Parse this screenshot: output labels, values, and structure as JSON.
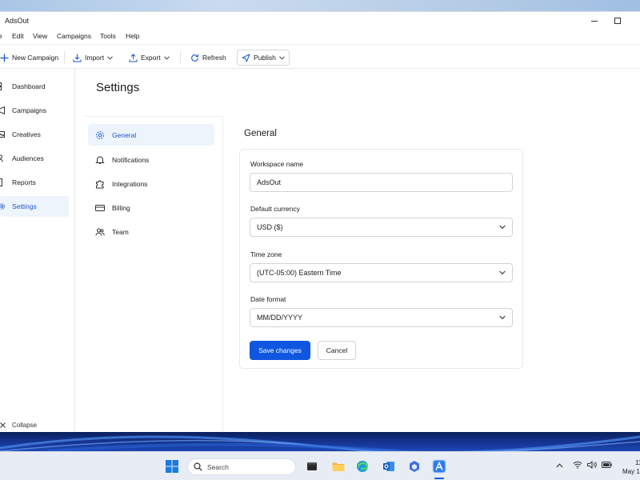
{
  "app": {
    "title": "AdsOut"
  },
  "menu": [
    "e",
    "Edit",
    "View",
    "Campaigns",
    "Tools",
    "Help"
  ],
  "toolbar": {
    "new_campaign": "New Campaign",
    "import": "Import",
    "export": "Export",
    "refresh": "Refresh",
    "publish": "Publish"
  },
  "sidebar": {
    "items": [
      {
        "label": "Dashboard",
        "icon": "dashboard-icon"
      },
      {
        "label": "Campaigns",
        "icon": "megaphone-icon"
      },
      {
        "label": "Creatives",
        "icon": "image-icon"
      },
      {
        "label": "Audiences",
        "icon": "people-icon"
      },
      {
        "label": "Reports",
        "icon": "chart-icon"
      },
      {
        "label": "Settings",
        "icon": "gear-icon",
        "active": true
      }
    ],
    "collapse": "Collapse"
  },
  "settings": {
    "title": "Settings",
    "nav": [
      {
        "label": "General",
        "icon": "gear-icon",
        "active": true
      },
      {
        "label": "Notifications",
        "icon": "bell-icon"
      },
      {
        "label": "Integrations",
        "icon": "puzzle-icon"
      },
      {
        "label": "Billing",
        "icon": "card-icon"
      },
      {
        "label": "Team",
        "icon": "people-icon"
      }
    ],
    "general": {
      "heading": "General",
      "workspace_label": "Workspace name",
      "workspace_value": "AdsOut",
      "currency_label": "Default currency",
      "currency_value": "USD ($)",
      "timezone_label": "Time zone",
      "timezone_value": "(UTC-05:00) Eastern Time",
      "dateformat_label": "Date format",
      "dateformat_value": "MM/DD/YYYY",
      "save": "Save changes",
      "cancel": "Cancel"
    }
  },
  "taskbar": {
    "search_placeholder": "Search",
    "clock_time": "11",
    "clock_date": "May 1"
  },
  "colors": {
    "accent": "#0f56e0",
    "active_bg": "#eef4fc"
  }
}
